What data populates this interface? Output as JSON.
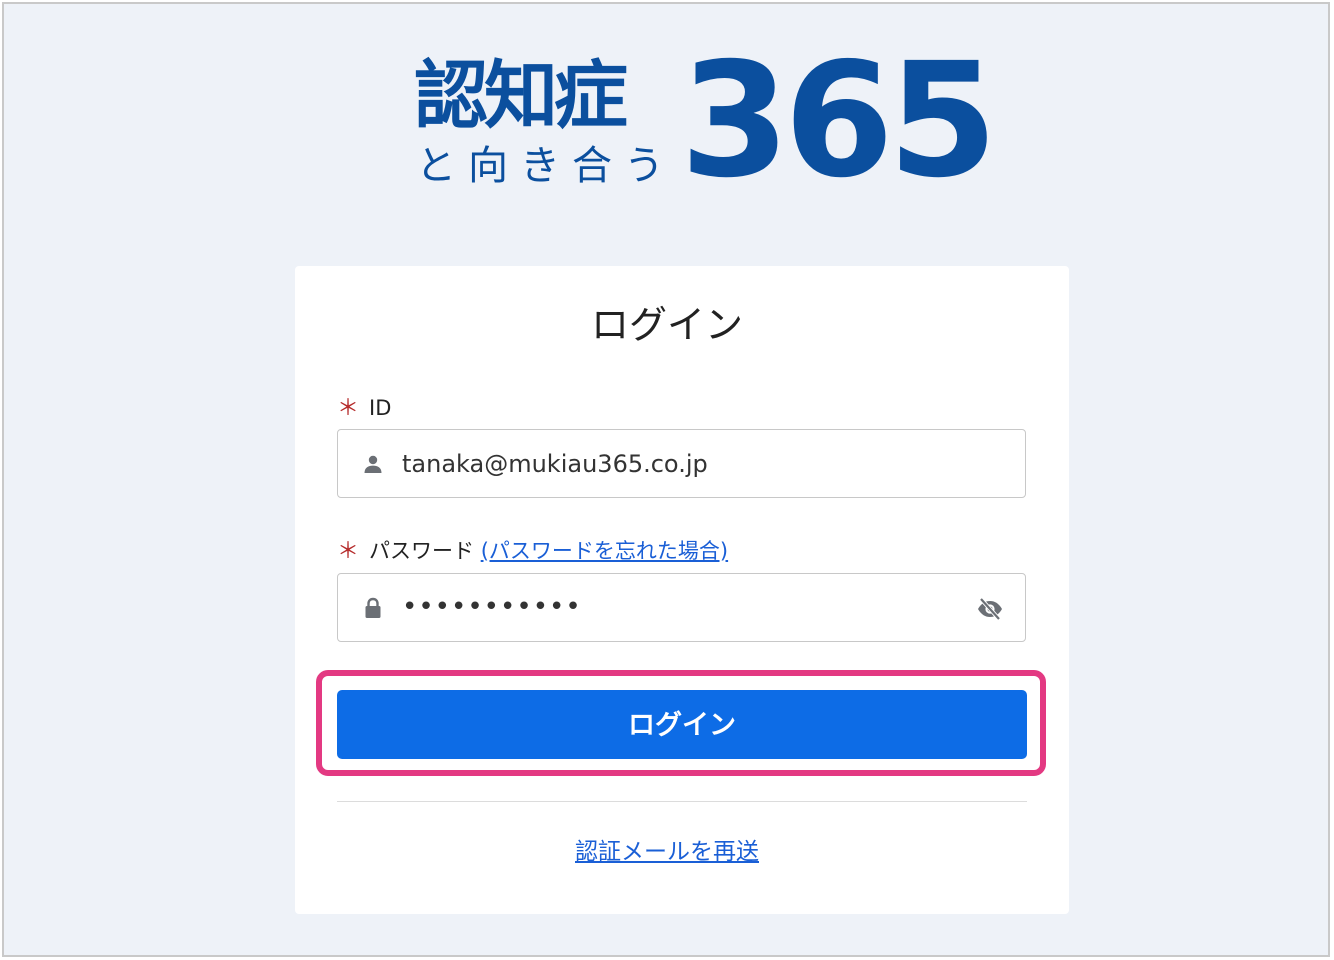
{
  "logo": {
    "kanji": "認知症",
    "sub": "と向き合う",
    "number": "365"
  },
  "login": {
    "title": "ログイン",
    "id_field": {
      "required_mark": "＊",
      "label": "ID",
      "value": "tanaka@mukiau365.co.jp",
      "icon": "person-icon"
    },
    "password_field": {
      "required_mark": "＊",
      "label": "パスワード",
      "forgot_link": "(パスワードを忘れた場合)",
      "value_masked": "•••••••••••",
      "icon": "lock-icon",
      "toggle_icon": "eye-off-icon"
    },
    "submit_label": "ログイン",
    "resend_link": "認証メールを再送"
  },
  "colors": {
    "brand": "#0b4f9e",
    "button": "#0d6ce6",
    "highlight": "#e33982",
    "link": "#1a5fd6",
    "required": "#b52b2b",
    "background": "#eef2f8"
  }
}
